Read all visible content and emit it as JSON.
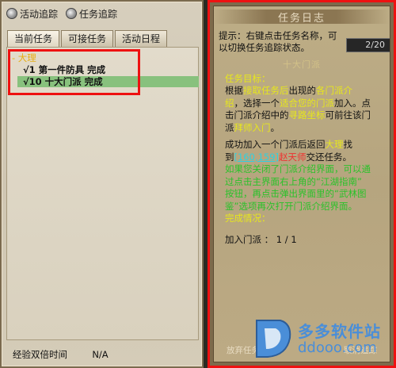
{
  "left": {
    "options": [
      {
        "label": "活动追踪"
      },
      {
        "label": "任务追踪"
      }
    ],
    "tabs": [
      "当前任务",
      "可接任务",
      "活动日程"
    ],
    "tree": {
      "group": "- 大理",
      "items": [
        "√1  第一件防具  完成",
        "√10  十大门派  完成"
      ]
    },
    "bottom": {
      "label": "经验双倍时间",
      "value": "N/A"
    }
  },
  "right": {
    "title": "任务日志",
    "hint": "提示：右键点击任务名称，可以切换任务追踪状态。",
    "counter": "2/20",
    "subtitle": "十大门派",
    "goal_label": "任务目标：",
    "goal_lines": [
      [
        "    根据",
        "接取任务后",
        "出现的",
        "各门派介"
      ],
      [
        "绍",
        "，选择一个",
        "适合您的门派",
        "加入。点"
      ],
      [
        "击门派介绍中的",
        "寻路坐标",
        "可前往该门"
      ],
      [
        "派",
        "拜师入门",
        "。"
      ],
      [
        "    成功加入一个门派后返回",
        "大理",
        "找"
      ],
      [
        "到",
        "[160,159]",
        "赵天师",
        "交还任务。"
      ],
      [
        "如果您关闭了门派介绍界面，可以通"
      ],
      [
        "过点击主界面右上角的“江湖指南”"
      ],
      [
        "按钮，再点击弹出界面里的“武林图"
      ],
      [
        "鉴”选项再次打开门派介绍界面。"
      ]
    ],
    "status_label": "完成情况：",
    "status_value": "加入门派  ： 1 / 1",
    "buttons": [
      "放弃任务",
      "取消追踪"
    ]
  },
  "watermark": {
    "line1": "多多软件站",
    "line2": "ddooo.com"
  }
}
